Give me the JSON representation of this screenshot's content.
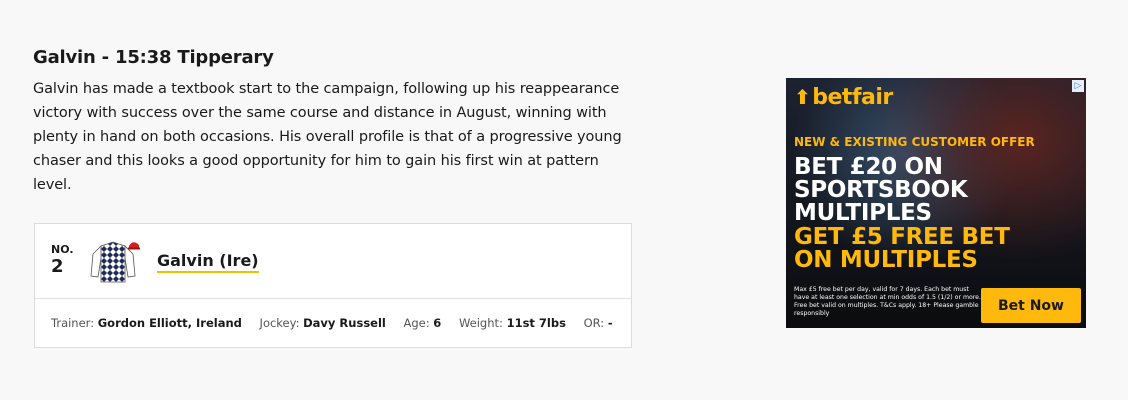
{
  "article": {
    "title": "Galvin - 15:38 Tipperary",
    "body": "Galvin has made a textbook start to the campaign, following up his reappearance victory with success over the same course and distance in August, winning with plenty in hand on both occasions. His overall profile is that of a progressive young chaser and this looks a good opportunity for him to gain his first win at pattern level."
  },
  "runner": {
    "no_label": "NO.",
    "no_value": "2",
    "silks_icon": "jockey-silks-icon",
    "name": "Galvin (Ire)",
    "stats": [
      {
        "label": "Trainer:",
        "value": "Gordon Elliott, Ireland"
      },
      {
        "label": "Jockey:",
        "value": "Davy Russell"
      },
      {
        "label": "Age:",
        "value": "6"
      },
      {
        "label": "Weight:",
        "value": "11st 7lbs"
      },
      {
        "label": "OR:",
        "value": "-"
      }
    ]
  },
  "ad": {
    "brand": "betfair",
    "offer": "NEW & EXISTING CUSTOMER OFFER",
    "headline": [
      "BET £20 ON",
      "SPORTSBOOK",
      "MULTIPLES"
    ],
    "highlight": [
      "GET £5 FREE BET",
      "ON MULTIPLES"
    ],
    "terms": "Max £5 free bet per day, valid for 7 days. Each bet must have at least one selection at min odds of 1.5 (1/2) or more. Free bet valid on multiples. T&Cs apply. 18+ Please gamble responsibly",
    "cta": "Bet Now",
    "accent_color": "#ffb80c"
  }
}
